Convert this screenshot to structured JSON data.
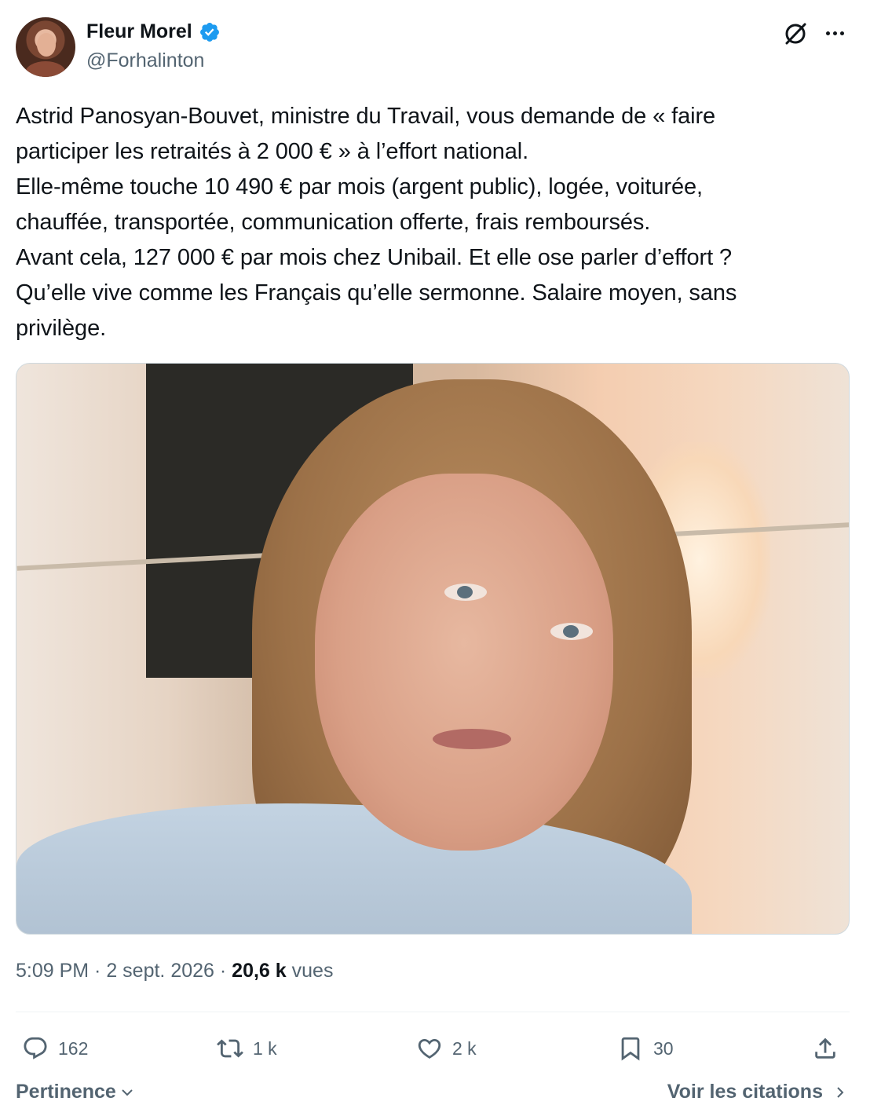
{
  "author": {
    "display_name": "Fleur Morel",
    "handle": "@Forhalinton",
    "verified": true
  },
  "header_icons": [
    "grok-icon",
    "more-icon"
  ],
  "tweet": {
    "lines": [
      "Astrid Panosyan-Bouvet, ministre du Travail, vous demande de « faire",
      "participer les retraités à 2 000 € » à l’effort national.",
      "Elle-même touche 10 490 € par mois (argent public), logée, voiturée,",
      "chauffée, transportée, communication offerte, frais remboursés.",
      "Avant cela, 127 000 € par mois chez Unibail. Et elle ose parler d’effort ?",
      "Qu’elle vive comme les Français qu’elle sermonne. Salaire moyen, sans",
      "privilège."
    ]
  },
  "meta": {
    "time": "5:09 PM",
    "separator1": " · ",
    "date": "2 sept. 2026",
    "separator2": " · ",
    "views_count": "20,6 k",
    "views_label": " vues"
  },
  "actions": {
    "replies": "162",
    "reposts": "1 k",
    "likes": "2 k",
    "bookmarks": "30"
  },
  "footer": {
    "sort_label": "Pertinence",
    "quotes_label": "Voir les citations"
  },
  "colors": {
    "text_primary": "#0f1419",
    "text_secondary": "#536471",
    "verified_blue": "#1d9bf0",
    "border": "#cfd9de"
  }
}
